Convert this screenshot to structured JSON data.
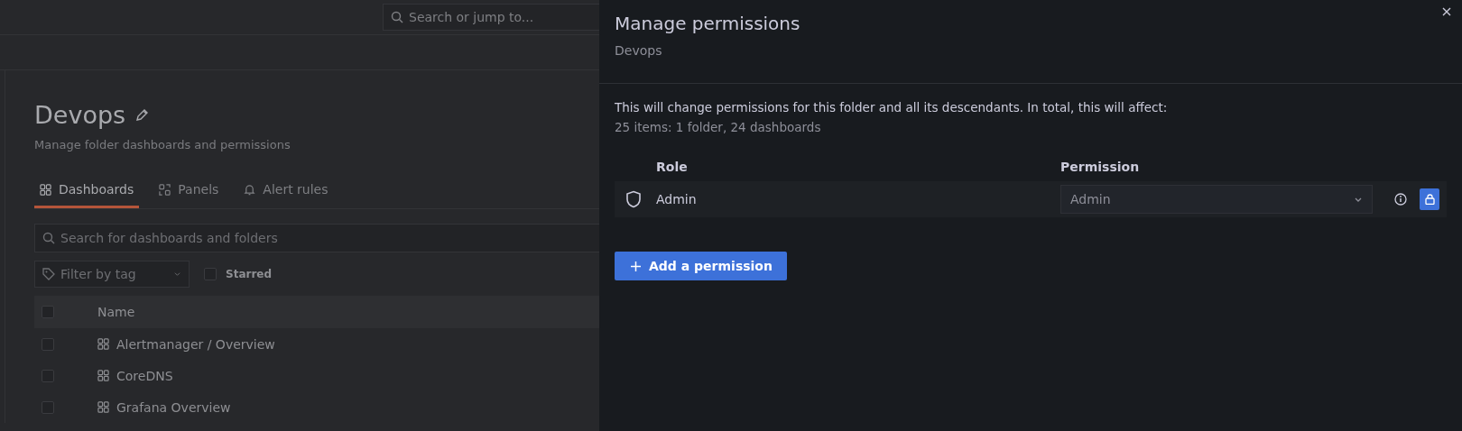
{
  "background_page": {
    "top_search": {
      "placeholder": "Search or jump to..."
    },
    "title": "Devops",
    "subtitle": "Manage folder dashboards and permissions",
    "tabs": [
      {
        "label": "Dashboards",
        "selected": true
      },
      {
        "label": "Panels",
        "selected": false
      },
      {
        "label": "Alert rules",
        "selected": false
      }
    ],
    "search": {
      "placeholder": "Search for dashboards and folders"
    },
    "tag_filter": {
      "placeholder": "Filter by tag"
    },
    "starred_filter": {
      "label": "Starred",
      "checked": false
    },
    "table": {
      "columns": [
        "Name"
      ],
      "header_checked": false,
      "rows": [
        {
          "name": "Alertmanager / Overview",
          "checked": false
        },
        {
          "name": "CoreDNS",
          "checked": false
        },
        {
          "name": "Grafana Overview",
          "checked": false
        }
      ]
    }
  },
  "drawer": {
    "title": "Manage permissions",
    "subtitle": "Devops",
    "notice": "This will change permissions for this folder and all its descendants. In total, this will affect:",
    "summary": "25 items: 1 folder, 24 dashboards",
    "columns": [
      "Role",
      "Permission"
    ],
    "permissions": [
      {
        "role": "Admin",
        "permission": "Admin",
        "locked": true
      }
    ],
    "add_button": "Add a permission"
  }
}
